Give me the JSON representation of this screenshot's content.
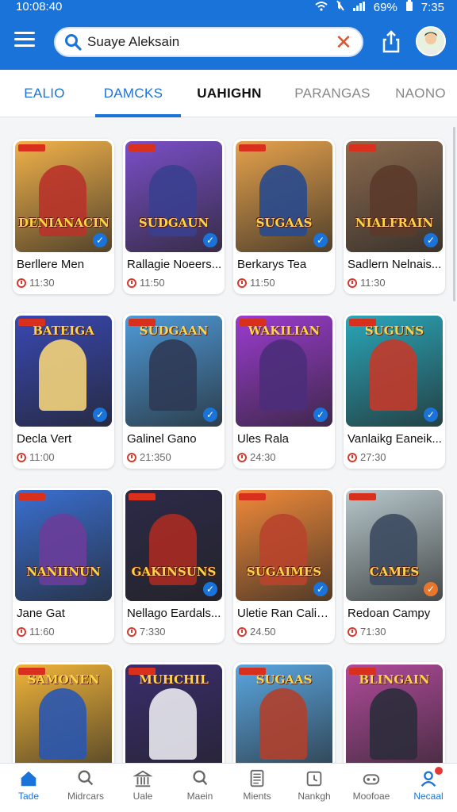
{
  "status_bar": {
    "time": "10:08:40",
    "battery": "69%",
    "clock_right": "7:35"
  },
  "search": {
    "value": "Suaye Aleksain",
    "clear_symbol": "✕"
  },
  "tabs": [
    {
      "label": "EALIO"
    },
    {
      "label": "DAMCKS"
    },
    {
      "label": "UAHIGHN"
    },
    {
      "label": "PARANGAS"
    },
    {
      "label": "NAONO"
    }
  ],
  "cards": [
    {
      "name": "Berllere Men",
      "time": "11:30",
      "art_text": "DENIANACIN",
      "color": "#b8332a",
      "bg": "#f2b24a",
      "check": "blue"
    },
    {
      "name": "Rallagie Noeers...",
      "time": "11:50",
      "art_text": "SUDGAUN",
      "color": "#3a3f8f",
      "bg": "#7a4fc8",
      "check": "blue"
    },
    {
      "name": "Berkarys Tea",
      "time": "11:50",
      "art_text": "SUGAAS",
      "color": "#284a8e",
      "bg": "#e6a24c",
      "check": "blue"
    },
    {
      "name": "Sadlern Nelnais...",
      "time": "11:30",
      "art_text": "NIALFRAIN",
      "color": "#5b3a2a",
      "bg": "#8a6a4e",
      "check": "blue"
    },
    {
      "name": "Decla Vert",
      "time": "11:00",
      "art_text": "BATEIGA",
      "color": "#f3d37a",
      "bg": "#3848b2",
      "check": "blue"
    },
    {
      "name": "Galinel Gano",
      "time": "21:350",
      "art_text": "SUDGAAN",
      "color": "#2f3a55",
      "bg": "#4e9ad8",
      "check": "blue"
    },
    {
      "name": "Ules Rala",
      "time": "24:30",
      "art_text": "WAKILIAN",
      "color": "#4b2d7a",
      "bg": "#9b3ccf",
      "check": "blue"
    },
    {
      "name": "Vanlaikg Eaneik...",
      "time": "27:30",
      "art_text": "SUGUNS",
      "color": "#c23a2a",
      "bg": "#2aa6b8",
      "check": "blue"
    },
    {
      "name": "Jane Gat",
      "time": "11:60",
      "art_text": "NANIINUN",
      "color": "#6a3d9a",
      "bg": "#3a6fd1",
      "check": "none"
    },
    {
      "name": "Nellago Eardals...",
      "time": "7:330",
      "art_text": "GAKINSUNS",
      "color": "#a82a22",
      "bg": "#2c2a48",
      "check": "blue"
    },
    {
      "name": "Uletie Ran Calis...",
      "time": "24.50",
      "art_text": "SUGAIMES",
      "color": "#b8442c",
      "bg": "#f08a3a",
      "check": "blue"
    },
    {
      "name": "Redoan Campy",
      "time": "71:30",
      "art_text": "CAMES",
      "color": "#3c4a60",
      "bg": "#b8c8cc",
      "check": "orange"
    },
    {
      "name": "",
      "time": "",
      "art_text": "SAMONEN",
      "color": "#2a57b0",
      "bg": "#f0b43a",
      "check": "none"
    },
    {
      "name": "",
      "time": "",
      "art_text": "MUHCHIL",
      "color": "#e9e9f0",
      "bg": "#3a2d6e",
      "check": "none"
    },
    {
      "name": "",
      "time": "",
      "art_text": "SUGAAS",
      "color": "#b0402c",
      "bg": "#5aa6e0",
      "check": "none"
    },
    {
      "name": "",
      "time": "",
      "art_text": "BLINGAIN",
      "color": "#2c2c3c",
      "bg": "#b04a9a",
      "check": "none"
    }
  ],
  "bottom_nav": [
    {
      "label": "Tade",
      "icon": "home-icon"
    },
    {
      "label": "Midrcars",
      "icon": "search-icon"
    },
    {
      "label": "Uale",
      "icon": "bank-icon"
    },
    {
      "label": "Maein",
      "icon": "magnifier-icon"
    },
    {
      "label": "Mients",
      "icon": "document-icon"
    },
    {
      "label": "Nankgh",
      "icon": "clock-icon"
    },
    {
      "label": "Moofoae",
      "icon": "gamepad-icon"
    },
    {
      "label": "Necaal",
      "icon": "profile-icon"
    }
  ],
  "colors": {
    "primary": "#1a73d9",
    "clear_accent": "#e0542e",
    "badge_red": "#e53935"
  }
}
